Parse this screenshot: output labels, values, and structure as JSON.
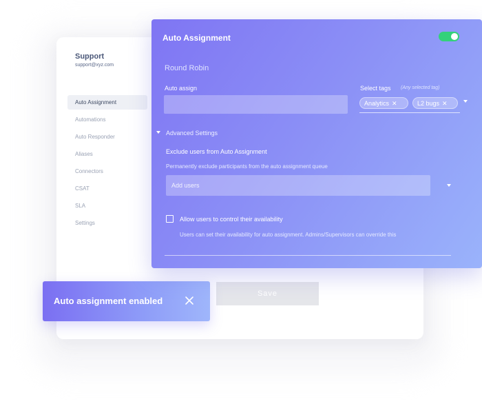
{
  "sidebar": {
    "org_name": "Support",
    "org_email": "support@xyz.com",
    "items": [
      {
        "label": "Auto Assignment"
      },
      {
        "label": "Automations"
      },
      {
        "label": "Auto Responder"
      },
      {
        "label": "Aliases"
      },
      {
        "label": "Connectors"
      },
      {
        "label": "CSAT"
      },
      {
        "label": "SLA"
      },
      {
        "label": "Settings"
      }
    ],
    "active_index": 0
  },
  "page": {
    "save_label": "Save"
  },
  "modal": {
    "title": "Auto Assignment",
    "toggle_on": true,
    "toggle_color": "#33d17a",
    "section_title": "Round Robin",
    "auto_assign_label": "Auto assign",
    "auto_assign_value": "",
    "tags_label": "Select tags",
    "tags_hint": "(Any selected tag)",
    "tags": [
      {
        "label": "Analytics",
        "remove": "✕"
      },
      {
        "label": "L2 bugs",
        "remove": "✕"
      }
    ],
    "advanced_label": "Advanced Settings",
    "exclude_title": "Exclude users from Auto Assignment",
    "exclude_subtitle": "Permanently exclude participants from the auto assignment queue",
    "add_users_placeholder": "Add users",
    "availability_label": "Allow users to control their availability",
    "availability_checked": false,
    "availability_description": "Users can set their availability for auto assignment. Admins/Supervisors can override this"
  },
  "toast": {
    "message": "Auto assignment enabled",
    "close_icon": "close-icon"
  },
  "colors": {
    "modal_gradient_start": "#7f75f3",
    "modal_gradient_end": "#9ab3fb",
    "toast_gradient_start": "#7b6ff2",
    "toast_gradient_end": "#9fb6fb"
  }
}
